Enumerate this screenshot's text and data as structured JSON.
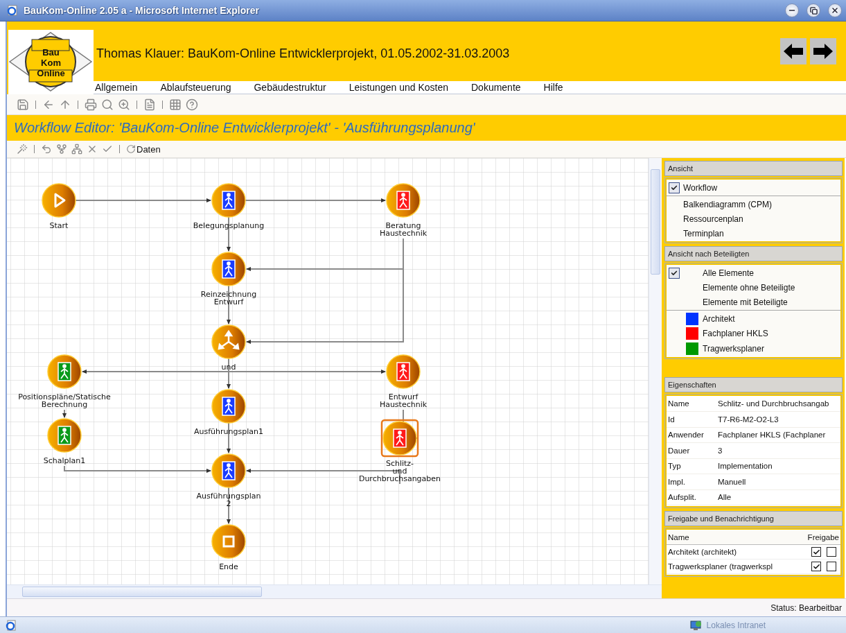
{
  "window": {
    "title": "BauKom-Online 2.05 a - Microsoft Internet Explorer"
  },
  "header": {
    "logo": [
      "Bau",
      "Kom",
      "Online"
    ],
    "project": "Thomas Klauer: BauKom-Online Entwicklerprojekt, 01.05.2002-31.03.2003"
  },
  "menu": [
    "Allgemein",
    "Ablaufsteuerung",
    "Gebäudestruktur",
    "Leistungen und Kosten",
    "Dokumente",
    "Hilfe"
  ],
  "editor_title": "Workflow Editor: 'BauKom-Online Entwicklerprojekt' - 'Ausführungsplanung'",
  "edit_toolbar": {
    "data_button": "Daten"
  },
  "canvas": {
    "nodes": [
      {
        "kind": "start",
        "label": "Start",
        "selected": false
      },
      {
        "kind": "activity",
        "label": "Belegungsplanung",
        "color": "#1a3cff",
        "selected": false
      },
      {
        "kind": "activity",
        "label": "Beratung Haustechnik",
        "color": "#ff1a1a",
        "selected": false
      },
      {
        "kind": "activity",
        "label": "Reinzeichnung Entwurf",
        "color": "#1a3cff",
        "selected": false
      },
      {
        "kind": "split",
        "label": "und",
        "selected": false
      },
      {
        "kind": "activity",
        "label": "Positionspläne/Statische Berechnung",
        "color": "#0a9a1a",
        "selected": false
      },
      {
        "kind": "activity",
        "label": "Entwurf Haustechnik",
        "color": "#ff1a1a",
        "selected": false
      },
      {
        "kind": "activity",
        "label": "Ausführungsplan1",
        "color": "#1a3cff",
        "selected": false
      },
      {
        "kind": "activity",
        "label": "Schalplan1",
        "color": "#0a9a1a",
        "selected": false
      },
      {
        "kind": "activity",
        "label": "Schlitz- und Durchbruchsangaben",
        "color": "#ff1a1a",
        "selected": true
      },
      {
        "kind": "activity",
        "label": "Ausführungsplan 2",
        "color": "#1a3cff",
        "selected": false
      },
      {
        "kind": "end",
        "label": "Ende",
        "selected": false
      }
    ]
  },
  "panel": {
    "view": {
      "title": "Ansicht",
      "items": [
        {
          "label": "Workflow",
          "selected": true
        },
        {
          "label": "Balkendiagramm (CPM)",
          "selected": false
        },
        {
          "label": "Ressourcenplan",
          "selected": false
        },
        {
          "label": "Terminplan",
          "selected": false
        }
      ]
    },
    "participants": {
      "title": "Ansicht nach Beteiligten",
      "options": [
        {
          "label": "Alle Elemente",
          "selected": true
        },
        {
          "label": "Elemente ohne Beteiligte",
          "selected": false
        },
        {
          "label": "Elemente mit Beteiligte",
          "selected": false
        }
      ],
      "legend": [
        {
          "label": "Architekt",
          "color": "#0033ff"
        },
        {
          "label": "Fachplaner HKLS",
          "color": "#ff0000"
        },
        {
          "label": "Tragwerksplaner",
          "color": "#009900"
        }
      ]
    },
    "properties": {
      "title": "Eigenschaften",
      "rows": [
        {
          "key": "Name",
          "value": "Schlitz- und Durchbruchsangab"
        },
        {
          "key": "Id",
          "value": "T7-R6-M2-O2-L3"
        },
        {
          "key": "Anwender",
          "value": "Fachplaner HKLS (Fachplaner"
        },
        {
          "key": "Dauer",
          "value": "3"
        },
        {
          "key": "Typ",
          "value": "Implementation"
        },
        {
          "key": "Impl.",
          "value": "Manuell"
        },
        {
          "key": "Aufsplit.",
          "value": "Alle"
        }
      ]
    },
    "release": {
      "title": "Freigabe und Benachrichtigung",
      "columns": [
        "Name",
        "Freigabe"
      ],
      "rows": [
        {
          "name": "Architekt (architekt)",
          "freigabe": true,
          "column_3": false
        },
        {
          "name": "Tragwerksplaner (tragwerkspl",
          "freigabe": true,
          "column_3": false
        }
      ]
    }
  },
  "status": "Status: Bearbeitbar",
  "browser_status": {
    "zone": "Lokales Intranet"
  }
}
